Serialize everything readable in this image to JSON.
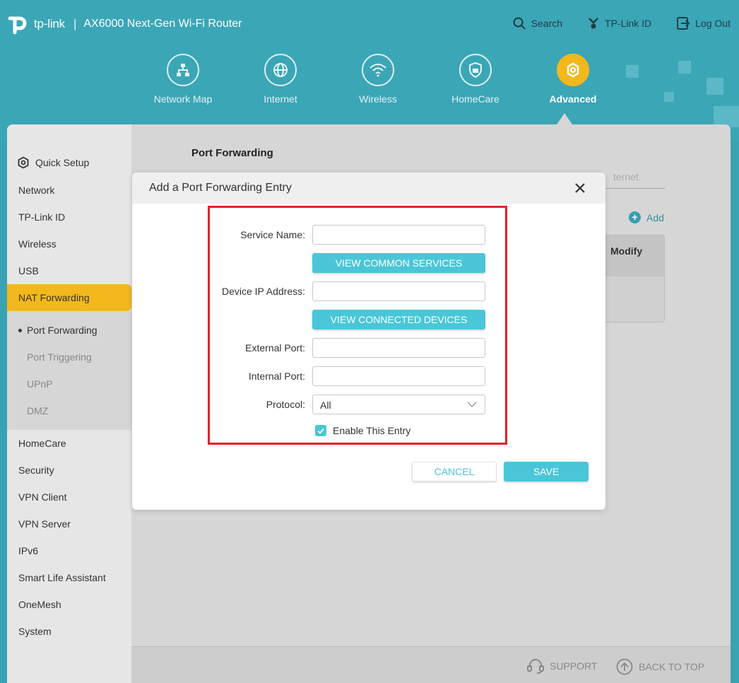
{
  "header": {
    "logo_text": "tp-link",
    "separator": "|",
    "product_title": "AX6000 Next-Gen Wi-Fi Router",
    "links": {
      "search": "Search",
      "tplink_id": "TP-Link ID",
      "logout": "Log Out"
    }
  },
  "nav": {
    "items": [
      {
        "label": "Network Map",
        "icon": "network-map-icon"
      },
      {
        "label": "Internet",
        "icon": "globe-icon"
      },
      {
        "label": "Wireless",
        "icon": "wifi-icon"
      },
      {
        "label": "HomeCare",
        "icon": "shield-icon"
      },
      {
        "label": "Advanced",
        "icon": "gear-icon",
        "active": true
      }
    ]
  },
  "sidebar": {
    "items": [
      {
        "label": "Quick Setup"
      },
      {
        "label": "Network"
      },
      {
        "label": "TP-Link ID"
      },
      {
        "label": "Wireless"
      },
      {
        "label": "USB"
      },
      {
        "label": "NAT Forwarding",
        "active": true
      },
      {
        "label": "HomeCare"
      },
      {
        "label": "Security"
      },
      {
        "label": "VPN Client"
      },
      {
        "label": "VPN Server"
      },
      {
        "label": "IPv6"
      },
      {
        "label": "Smart Life Assistant"
      },
      {
        "label": "OneMesh"
      },
      {
        "label": "System"
      }
    ],
    "subitems": [
      {
        "label": "Port Forwarding",
        "current": true
      },
      {
        "label": "Port Triggering"
      },
      {
        "label": "UPnP"
      },
      {
        "label": "DMZ"
      }
    ]
  },
  "main": {
    "title": "Port Forwarding",
    "partial_text": "ternet.",
    "add_label": "Add",
    "table_header_modify": "Modify"
  },
  "modal": {
    "title": "Add a Port Forwarding Entry",
    "service_name_label": "Service Name:",
    "service_name_value": "",
    "view_services_label": "VIEW COMMON SERVICES",
    "device_ip_label": "Device IP Address:",
    "device_ip_value": "",
    "view_devices_label": "VIEW CONNECTED DEVICES",
    "external_port_label": "External Port:",
    "external_port_value": "",
    "internal_port_label": "Internal Port:",
    "internal_port_value": "",
    "protocol_label": "Protocol:",
    "protocol_value": "All",
    "enable_label": "Enable This Entry",
    "enable_checked": true,
    "cancel_label": "CANCEL",
    "save_label": "SAVE"
  },
  "footer": {
    "support": "SUPPORT",
    "back_to_top": "BACK TO TOP"
  },
  "colors": {
    "header_bg": "#3ba6b6",
    "accent_yellow": "#f3b81c",
    "button_teal": "#4ac6d8",
    "highlight_red": "#e32026"
  }
}
